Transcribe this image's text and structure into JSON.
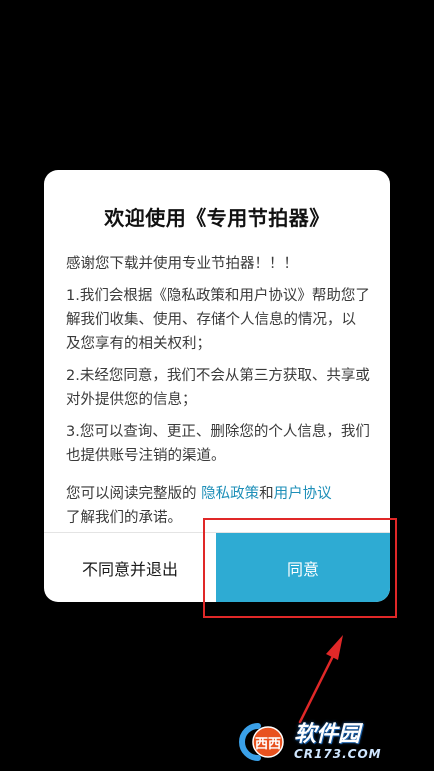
{
  "dialog": {
    "title": "欢迎使用《专用节拍器》",
    "intro": "感谢您下载并使用专业节拍器！！！",
    "points": [
      "1.我们会根据《隐私政策和用户协议》帮助您了解我们收集、使用、存储个人信息的情况，以及您享有的相关权利；",
      "2.未经您同意，我们不会从第三方获取、共享或对外提供您的信息；",
      "3.您可以查询、更正、删除您的个人信息，我们也提供账号注销的渠道。"
    ],
    "notice": {
      "prefix": "您可以阅读完整版的 ",
      "privacy_link": "隐私政策",
      "conjunction": "和",
      "terms_link": "用户协议",
      "suffix": "了解我们的承诺。"
    },
    "decline_label": "不同意并退出",
    "agree_label": "同意"
  },
  "watermark": {
    "logo_text": "西西",
    "brand_text": "软件园",
    "url_text": "CR173.COM"
  },
  "colors": {
    "background": "#000000",
    "dialog_bg": "#ffffff",
    "agree_button": "#2eabd3",
    "link": "#1e8fb8",
    "annotation": "#e02828"
  }
}
